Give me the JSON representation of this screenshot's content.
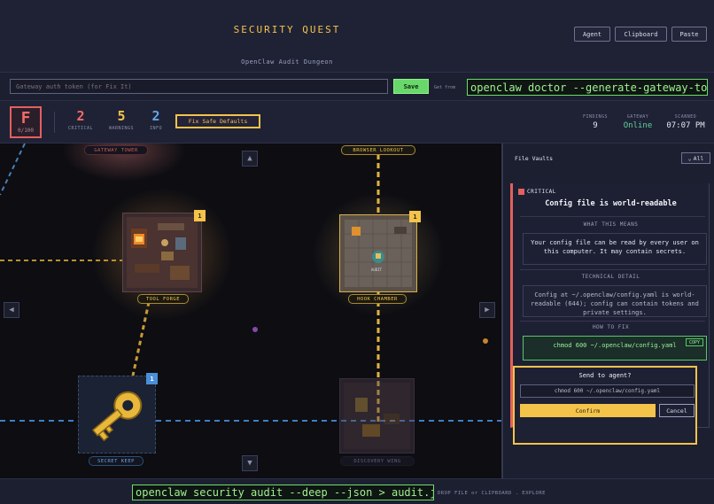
{
  "header": {
    "title": "SECURITY QUEST",
    "subtitle": "OpenClaw Audit Dungeon",
    "buttons": {
      "agent": "Agent",
      "clipboard": "Clipboard",
      "paste": "Paste"
    }
  },
  "token": {
    "placeholder": "Gateway auth token (for Fix It)",
    "save_label": "Save",
    "get_from": "Get from",
    "command": "openclaw doctor --generate-gateway-token"
  },
  "stats": {
    "grade": "F",
    "score": "0/100",
    "critical": {
      "value": "2",
      "label": "CRITICAL"
    },
    "warnings": {
      "value": "5",
      "label": "WARNINGS"
    },
    "info": {
      "value": "2",
      "label": "INFO"
    },
    "fix_safe_defaults": "Fix Safe Defaults",
    "findings": {
      "label": "FINDINGS",
      "value": "9"
    },
    "gateway": {
      "label": "GATEWAY",
      "value": "Online"
    },
    "scanned": {
      "label": "SCANNED",
      "value": "07:07 PM"
    }
  },
  "colors": {
    "critical": "#f26a67",
    "warning": "#f3c34a",
    "info": "#63a6e8",
    "online": "#5fd39a",
    "accent": "#f3c34a"
  },
  "map": {
    "rooms": {
      "gateway_tower": {
        "label": "GATEWAY TOWER"
      },
      "browser_lookout": {
        "label": "BROWSER LOOKOUT"
      },
      "tool_forge": {
        "label": "TOOL FORGE",
        "badge": "1"
      },
      "hook_chamber": {
        "label": "HOOK CHAMBER",
        "badge": "1",
        "sign": "AUDIT"
      },
      "secret_keep": {
        "label": "SECRET KEEP",
        "badge": "1"
      },
      "discovery_wing": {
        "label": "DISCOVERY WING"
      }
    },
    "nav": {
      "up": "▲",
      "down": "▼",
      "left": "◀",
      "right": "▶"
    }
  },
  "panel": {
    "title": "File Vaults",
    "filter": "All",
    "finding": {
      "severity": "CRITICAL",
      "title": "Config file is world-readable",
      "what_header": "WHAT THIS MEANS",
      "what_text": "Your config file can be read by every user on this computer. It may contain secrets.",
      "tech_header": "TECHNICAL DETAIL",
      "tech_text": "Config at ~/.openclaw/config.yaml is world-readable (644); config can contain tokens and private settings.",
      "fix_header": "HOW TO FIX",
      "fix_text": "chmod 600 ~/.openclaw/config.yaml",
      "copy": "COPY"
    },
    "send": {
      "title": "Send to agent?",
      "command": "chmod 600 ~/.openclaw/config.yaml",
      "confirm": "Confirm",
      "cancel": "Cancel"
    }
  },
  "footer": {
    "command": "openclaw security audit --deep --json > audit.json",
    "hint": "DROP FILE or CLIPBOARD . EXPLORE"
  }
}
